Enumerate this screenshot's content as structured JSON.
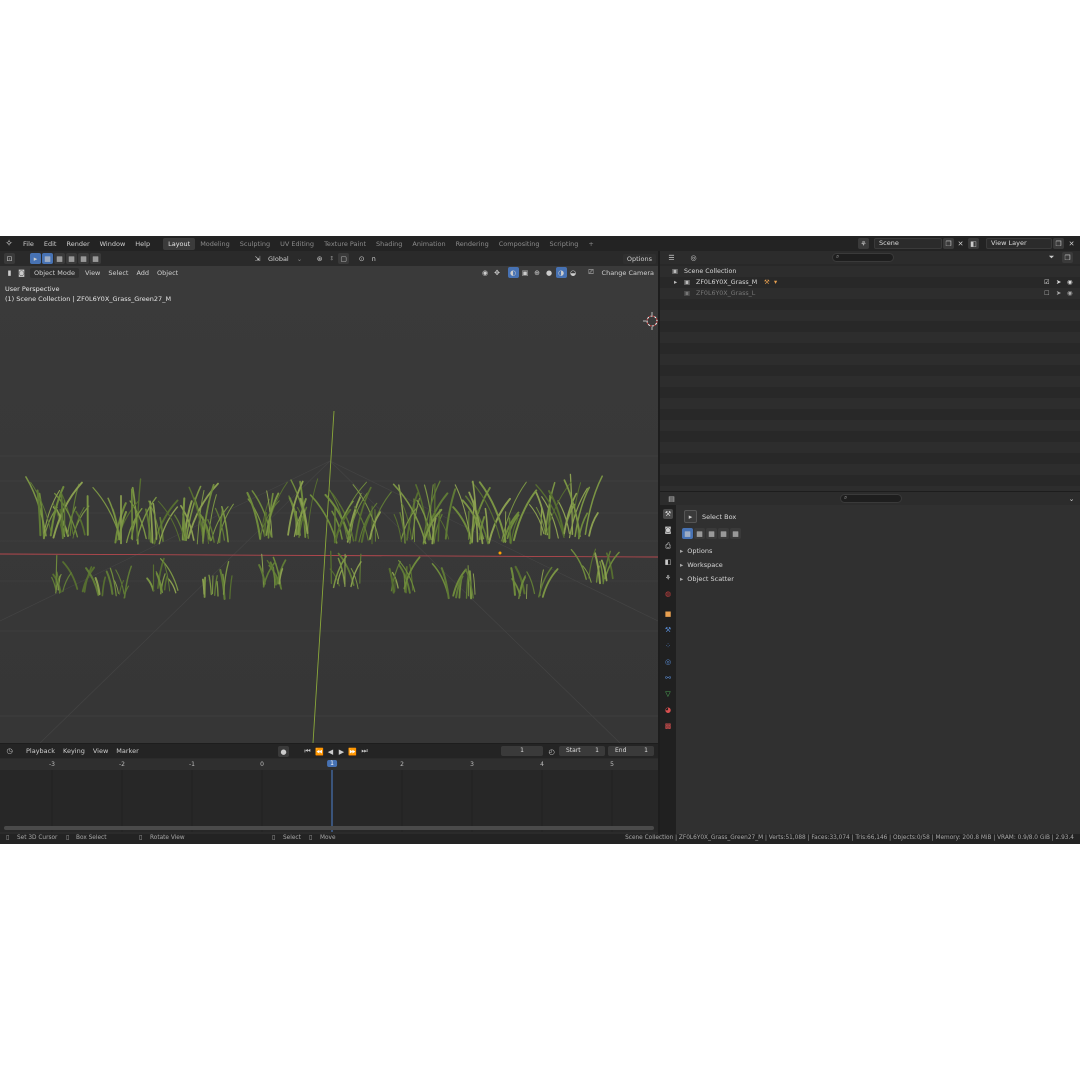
{
  "topbar": {
    "menu": [
      "File",
      "Edit",
      "Render",
      "Window",
      "Help"
    ],
    "workspaces": [
      "Layout",
      "Modeling",
      "Sculpting",
      "UV Editing",
      "Texture Paint",
      "Shading",
      "Animation",
      "Rendering",
      "Compositing",
      "Scripting"
    ],
    "add_tab": "+",
    "scene_name": "Scene",
    "view_layer": "View Layer"
  },
  "viewport": {
    "orientation": "Global",
    "options_label": "Options",
    "mode": "Object Mode",
    "menus": [
      "View",
      "Select",
      "Add",
      "Object"
    ],
    "change_camera": "Change Camera",
    "overlay_line1": "User Perspective",
    "overlay_line2": "(1) Scene Collection | ZF0L6Y0X_Grass_Green27_M"
  },
  "timeline": {
    "menus": [
      "Playback",
      "Keying",
      "View",
      "Marker"
    ],
    "current_frame": "1",
    "start_label": "Start",
    "start_value": "1",
    "end_label": "End",
    "end_value": "1",
    "ruler": [
      "-3",
      "-2",
      "-1",
      "0",
      "1",
      "2",
      "3",
      "4",
      "5"
    ]
  },
  "outliner": {
    "root": "Scene Collection",
    "items": [
      {
        "name": "ZF0L6Y0X_Grass_M"
      },
      {
        "name": "ZF0L6Y0X_Grass_L"
      }
    ]
  },
  "properties": {
    "tool_name": "Select Box",
    "panels": [
      "Options",
      "Workspace",
      "Object Scatter"
    ]
  },
  "statusbar": {
    "set_cursor": "Set 3D Cursor",
    "box_select": "Box Select",
    "rotate_view": "Rotate View",
    "select": "Select",
    "move": "Move",
    "stats": "Scene Collection | ZF0L6Y0X_Grass_Green27_M | Verts:51,088 | Faces:33,074 | Tris:66,146 | Objects:0/58 | Memory: 200.8 MiB | VRAM: 0.9/8.0 GiB | 2.93.4"
  },
  "colors": {
    "accent": "#4772b3",
    "x_axis": "#b5484e",
    "y_axis": "#8aa83a",
    "grass": "#5f7a36"
  }
}
